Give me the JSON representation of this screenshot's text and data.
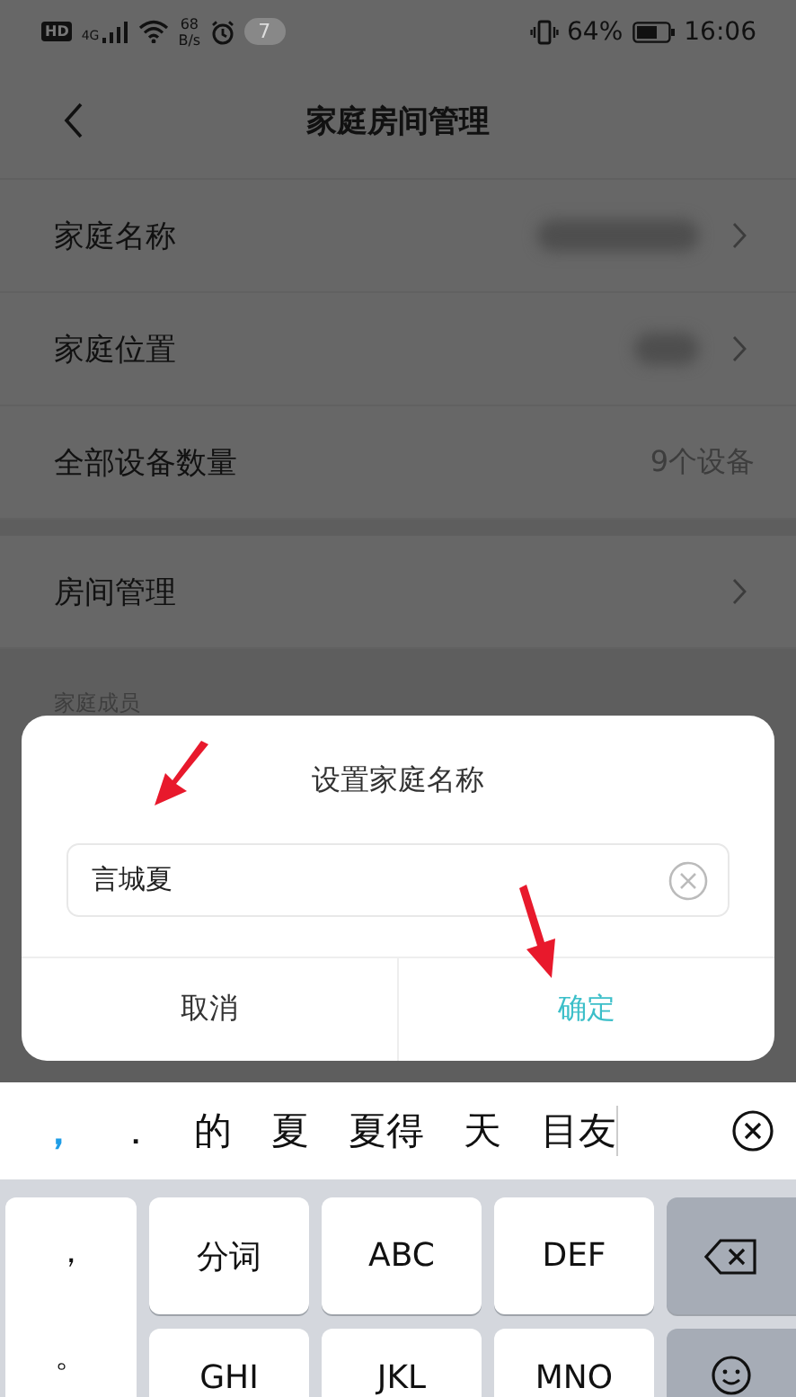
{
  "status_bar": {
    "hd": "HD",
    "network": "4G",
    "speed_value": "68",
    "speed_unit": "B/s",
    "notification_count": "7",
    "battery": "64%",
    "time": "16:06"
  },
  "header": {
    "title": "家庭房间管理"
  },
  "settings": [
    {
      "label": "家庭名称",
      "kind": "redacted_long"
    },
    {
      "label": "家庭位置",
      "kind": "redacted_short"
    },
    {
      "label": "全部设备数量",
      "kind": "value",
      "value": "9个设备"
    }
  ],
  "rooms": {
    "label": "房间管理"
  },
  "members_section": {
    "label": "家庭成员"
  },
  "dialog": {
    "title": "设置家庭名称",
    "input_value": "言城夏",
    "cancel": "取消",
    "confirm": "确定"
  },
  "keyboard": {
    "candidates": [
      {
        "text": "，",
        "selected": true
      },
      {
        "text": "．",
        "selected": false
      },
      {
        "text": "的",
        "selected": false
      },
      {
        "text": "夏",
        "selected": false
      },
      {
        "text": "夏得",
        "selected": false
      },
      {
        "text": "天",
        "selected": false
      },
      {
        "text": "目友",
        "selected": false
      }
    ],
    "punctuation": [
      "，",
      "。"
    ],
    "rows": [
      [
        {
          "kind": "text",
          "label": "分词"
        },
        {
          "kind": "text",
          "label": "ABC"
        },
        {
          "kind": "text",
          "label": "DEF"
        },
        {
          "kind": "backspace"
        }
      ],
      [
        {
          "kind": "text",
          "label": "GHI"
        },
        {
          "kind": "text",
          "label": "JKL"
        },
        {
          "kind": "text",
          "label": "MNO"
        },
        {
          "kind": "emoji"
        }
      ]
    ]
  }
}
